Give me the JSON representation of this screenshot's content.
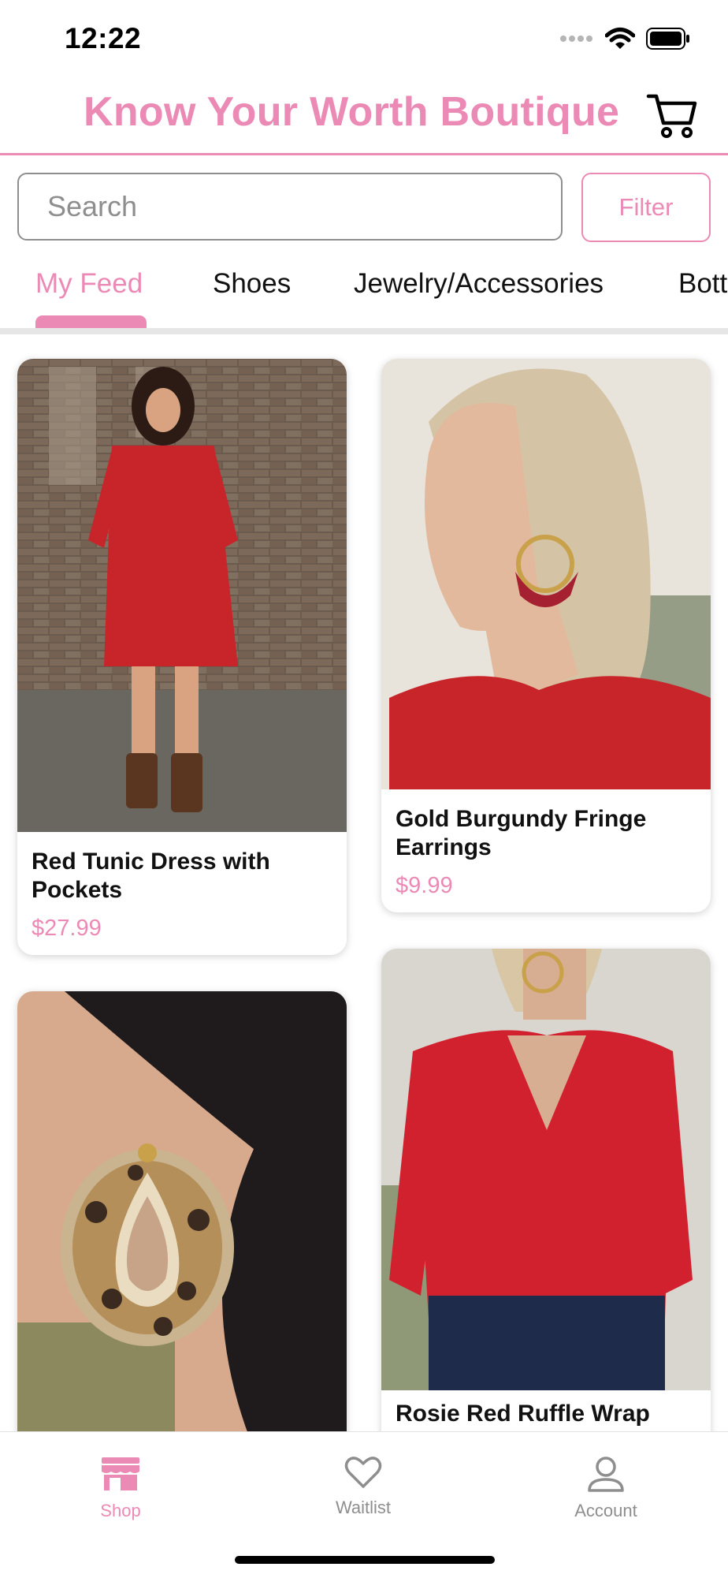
{
  "status_bar": {
    "time": "12:22",
    "icons": [
      "signal-dots-icon",
      "wifi-icon",
      "battery-icon"
    ]
  },
  "header": {
    "title": "Know Your Worth Boutique",
    "cart_icon": "cart-icon"
  },
  "search": {
    "placeholder": "Search",
    "value": "",
    "filter_label": "Filter"
  },
  "tabs": [
    {
      "label": "My Feed",
      "active": true
    },
    {
      "label": "Shoes",
      "active": false
    },
    {
      "label": "Jewelry/Accessories",
      "active": false
    },
    {
      "label": "Bott",
      "active": false
    }
  ],
  "products": [
    {
      "name_line1": "Red Tunic Dress with",
      "name_line2": "Pockets",
      "price": "$27.99"
    },
    {
      "name_line1": "Gold Burgundy Fringe",
      "name_line2": "Earrings",
      "price": "$9.99"
    },
    {
      "name_line1": "",
      "name_line2": "",
      "price": ""
    },
    {
      "name_line1": "Rosie Red Ruffle Wrap",
      "name_line2": "",
      "price": ""
    }
  ],
  "bottom_nav": [
    {
      "label": "Shop",
      "icon": "shop-icon",
      "active": true
    },
    {
      "label": "Waitlist",
      "icon": "heart-icon",
      "active": false
    },
    {
      "label": "Account",
      "icon": "person-icon",
      "active": false
    }
  ],
  "colors": {
    "accent": "#ec8ab6",
    "dress_red": "#c8252b",
    "muted_gray": "#8e8e8e"
  }
}
